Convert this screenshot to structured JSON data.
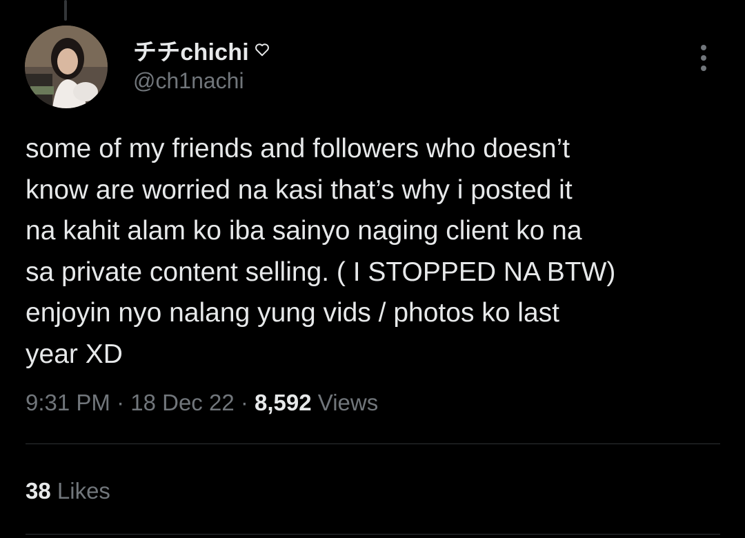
{
  "user": {
    "display_name": "チチchichi",
    "handle": "@ch1nachi",
    "avatar": "profile-photo",
    "name_icon": "heart-outline-icon"
  },
  "tweet": {
    "lines": [
      "some of my friends and followers who doesn’t",
      "know are worried na kasi that’s why i posted it",
      "na kahit alam ko iba sainyo naging client ko na",
      "sa private content selling. ( I STOPPED NA BTW)",
      "enjoyin nyo nalang yung vids / photos ko last",
      "year XD"
    ],
    "time": "9:31 PM",
    "date": "18 Dec 22",
    "separator": "·",
    "views_count": "8,592",
    "views_label": "Views",
    "likes_count": "38",
    "likes_label": "Likes"
  },
  "icons": {
    "more": "more-vertical-icon"
  },
  "colors": {
    "background": "#000000",
    "text_primary": "#e7e9ea",
    "text_secondary": "#71767b",
    "divider": "#2f3336"
  }
}
